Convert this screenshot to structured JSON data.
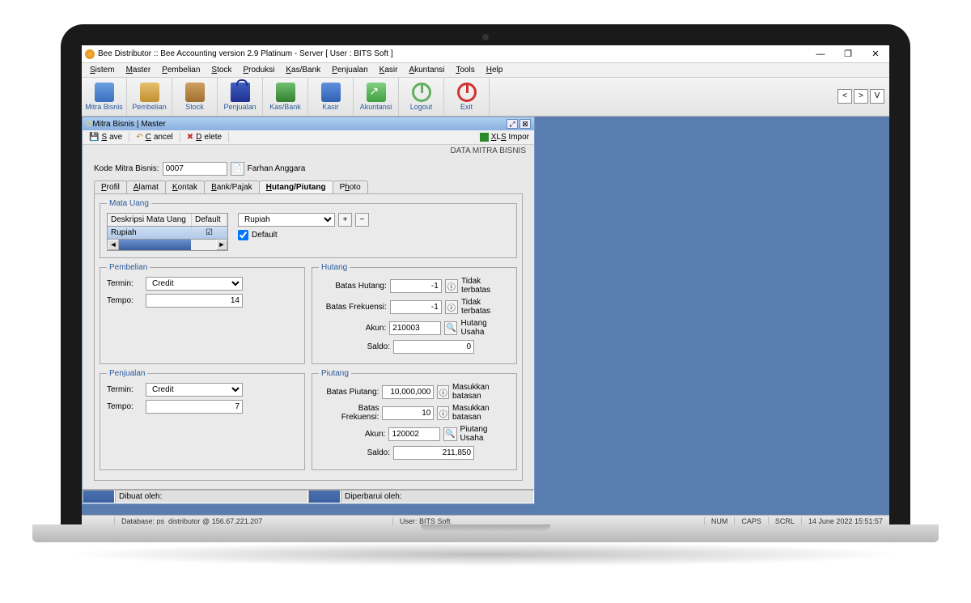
{
  "window": {
    "title": "Bee Distributor :: Bee Accounting version 2.9 Platinum - Server  [ User : BITS Soft ]"
  },
  "menu": {
    "items": [
      "Sistem",
      "Master",
      "Pembelian",
      "Stock",
      "Produksi",
      "Kas/Bank",
      "Penjualan",
      "Kasir",
      "Akuntansi",
      "Tools",
      "Help"
    ],
    "underline_first": [
      "S",
      "M",
      "P",
      "S",
      "P",
      "K",
      "P",
      "K",
      "A",
      "T",
      "H"
    ]
  },
  "toolbar": {
    "items": [
      {
        "label": "Mitra Bisnis",
        "icon": "ic-people"
      },
      {
        "label": "Pembelian",
        "icon": "ic-box"
      },
      {
        "label": "Stock",
        "icon": "ic-stock"
      },
      {
        "label": "Penjualan",
        "icon": "ic-bag"
      },
      {
        "label": "Kas/Bank",
        "icon": "ic-bank"
      },
      {
        "label": "Kasir",
        "icon": "ic-cart"
      },
      {
        "label": "Akuntansi",
        "icon": "ic-chart"
      },
      {
        "label": "Logout",
        "icon": "ic-logout"
      },
      {
        "label": "Exit",
        "icon": "ic-exit"
      }
    ],
    "nav_prev": "<",
    "nav_next": ">",
    "nav_v": "V"
  },
  "child": {
    "title": "Mitra Bisnis | Master",
    "actions": {
      "save": "Save",
      "cancel": "Cancel",
      "delete": "Delete",
      "xls": "XLS Impor"
    },
    "panel_title": "DATA MITRA BISNIS",
    "kode_label": "Kode Mitra Bisnis:",
    "kode_value": "0007",
    "kode_name": "Farhan Anggara",
    "tabs": [
      "Profil",
      "Alamat",
      "Kontak",
      "Bank/Pajak",
      "Hutang/Piutang",
      "Photo"
    ],
    "tabs_u": [
      "P",
      "A",
      "K",
      "B",
      "H",
      "h"
    ],
    "active_tab": 4,
    "mata_uang": {
      "legend": "Mata Uang",
      "head1": "Deskripsi Mata Uang",
      "head2": "Default",
      "row_name": "Rupiah",
      "row_default_checked": true,
      "select_value": "Rupiah",
      "default_cb_label": "Default",
      "default_cb_checked": true
    },
    "pembelian": {
      "legend": "Pembelian",
      "termin_label": "Termin:",
      "termin_value": "Credit",
      "tempo_label": "Tempo:",
      "tempo_value": "14"
    },
    "hutang": {
      "legend": "Hutang",
      "batas_label": "Batas Hutang:",
      "batas_value": "-1",
      "batas_hint": "Tidak terbatas",
      "freq_label": "Batas Frekuensi:",
      "freq_value": "-1",
      "freq_hint": "Tidak terbatas",
      "akun_label": "Akun:",
      "akun_value": "210003",
      "akun_name": "Hutang Usaha",
      "saldo_label": "Saldo:",
      "saldo_value": "0"
    },
    "penjualan": {
      "legend": "Penjualan",
      "termin_label": "Termin:",
      "termin_value": "Credit",
      "tempo_label": "Tempo:",
      "tempo_value": "7"
    },
    "piutang": {
      "legend": "Piutang",
      "batas_label": "Batas Piutang:",
      "batas_value": "10,000,000",
      "batas_hint": "Masukkan batasan",
      "freq_label": "Batas Frekuensi:",
      "freq_value": "10",
      "freq_hint": "Masukkan batasan",
      "akun_label": "Akun:",
      "akun_value": "120002",
      "akun_name": "Piutang Usaha",
      "saldo_label": "Saldo:",
      "saldo_value": "211,850"
    },
    "footer": {
      "created": "Dibuat oleh:",
      "updated": "Diperbarui oleh:"
    }
  },
  "statusbar": {
    "database": "Database: ps_distributor @ 156.67.221.207",
    "user": "User: BITS Soft",
    "num": "NUM",
    "caps": "CAPS",
    "scrl": "SCRL",
    "datetime": "14 June 2022  15:51:57"
  }
}
